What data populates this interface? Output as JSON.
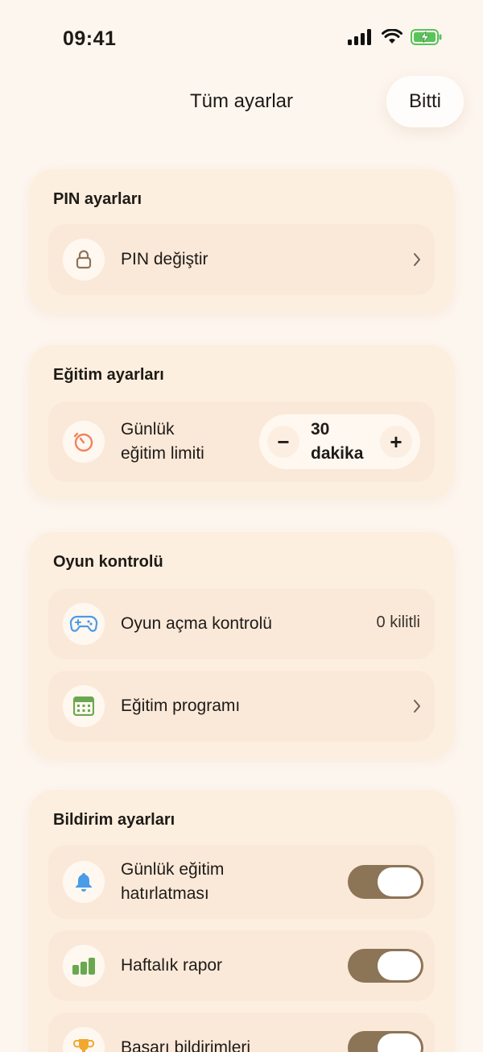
{
  "status_bar": {
    "time": "09:41"
  },
  "header": {
    "title": "Tüm ayarlar",
    "done_label": "Bitti"
  },
  "pin_section": {
    "title": "PIN ayarları",
    "change_pin_label": "PIN değiştir"
  },
  "education_section": {
    "title": "Eğitim ayarları",
    "daily_limit_label_line1": "Günlük",
    "daily_limit_label_line2": "eğitim limiti",
    "limit_value": "30",
    "limit_unit": "dakika",
    "minus": "−",
    "plus": "+"
  },
  "game_section": {
    "title": "Oyun kontrolü",
    "game_unlock_label": "Oyun açma kontrolü",
    "game_unlock_status": "0 kilitli",
    "program_label": "Eğitim programı"
  },
  "notification_section": {
    "title": "Bildirim ayarları",
    "daily_reminder_line1": "Günlük eğitim",
    "daily_reminder_line2": "hatırlatması",
    "weekly_report_label": "Haftalık rapor",
    "achievements_label": "Başarı bildirimleri",
    "daily_reminder_on": true,
    "weekly_report_on": true,
    "achievements_on": true
  },
  "colors": {
    "background": "#fdf6ef",
    "card": "#fdefdf",
    "row": "#fae9d9",
    "toggle_on": "#8c7457"
  }
}
